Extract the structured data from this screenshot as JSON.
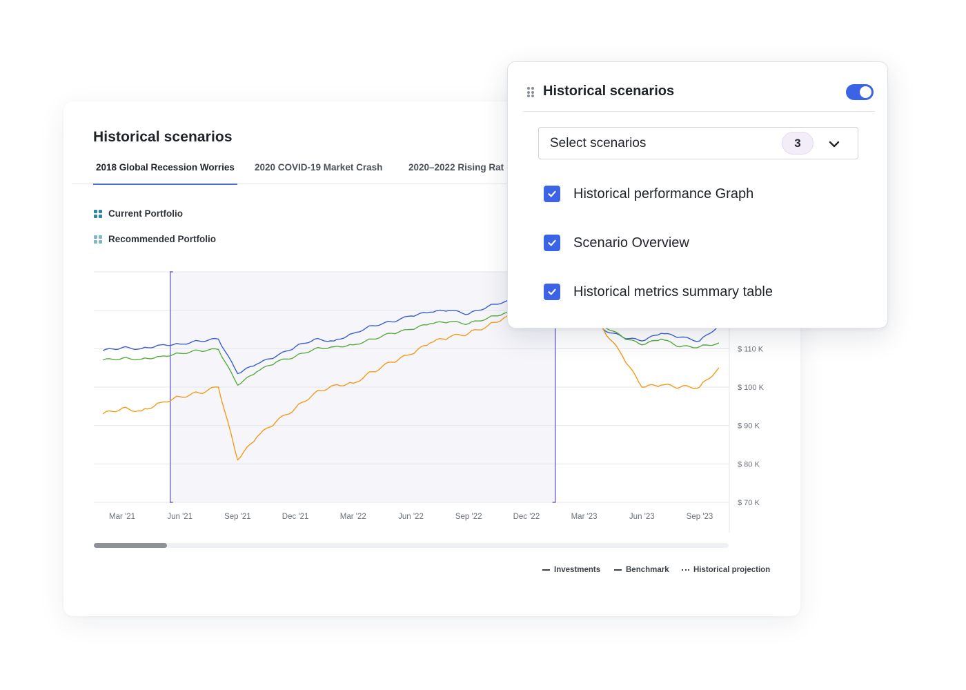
{
  "main_card": {
    "title": "Historical scenarios",
    "tabs": [
      {
        "label": "2018 Global Recession Worries",
        "active": true
      },
      {
        "label": "2020 COVID-19 Market Crash",
        "active": false
      },
      {
        "label": "2020–2022 Rising Rat",
        "active": false
      }
    ],
    "portfolio_legend": [
      {
        "label": "Current Portfolio",
        "color": "#2e86ab"
      },
      {
        "label": "Recommended Portfolio",
        "color": "#7fb8c4"
      }
    ],
    "line_legend": {
      "investments": "Investments",
      "benchmark": "Benchmark",
      "projection": "Historical projection"
    },
    "scrollbar": {
      "position_fraction": 0.0,
      "visible_fraction": 0.115
    }
  },
  "chart_data": {
    "type": "line",
    "x_ticks": [
      "Mar '21",
      "Jun '21",
      "Sep '21",
      "Dec '21",
      "Mar '22",
      "Jun '22",
      "Sep '22",
      "Dec '22",
      "Mar '23",
      "Jun '23",
      "Sep '23"
    ],
    "y_ticks": [
      "$ 110 K",
      "$ 100 K",
      "$ 90 K",
      "$ 80 K",
      "$ 70 K"
    ],
    "ylim": [
      70,
      130
    ],
    "y_unit": "K",
    "highlight_range": [
      "Jun '21",
      "Feb '23"
    ],
    "series": [
      {
        "color": "#3a5fcd",
        "x": [
          "Feb '21",
          "Mar '21",
          "Apr '21",
          "May '21",
          "Jun '21",
          "Jul '21",
          "Aug '21",
          "Sep '21",
          "Oct '21",
          "Nov '21",
          "Dec '21",
          "Jan '22",
          "Feb '22",
          "Mar '22",
          "Apr '22",
          "May '22",
          "Jun '22",
          "Jul '22",
          "Aug '22",
          "Sep '22",
          "Oct '22",
          "Nov '22",
          "Dec '22",
          "Mar '23",
          "Apr '23",
          "May '23",
          "Jun '23",
          "Jul '23",
          "Aug '23",
          "Sep '23",
          "Oct '23"
        ],
        "values": [
          109.5,
          110.3,
          110.0,
          111.0,
          111.2,
          112.0,
          112.5,
          103.5,
          106.0,
          108.0,
          110.5,
          112.5,
          112.0,
          114.0,
          116.0,
          117.0,
          118.5,
          119.5,
          120.0,
          119.0,
          121.0,
          122.5,
          124.0,
          124.0,
          115.0,
          113.0,
          112.0,
          114.0,
          113.0,
          112.0,
          116.0
        ]
      },
      {
        "color": "#5aab3f",
        "x": [
          "Feb '21",
          "Mar '21",
          "Apr '21",
          "May '21",
          "Jun '21",
          "Jul '21",
          "Aug '21",
          "Sep '21",
          "Oct '21",
          "Nov '21",
          "Dec '21",
          "Jan '22",
          "Feb '22",
          "Mar '22",
          "Apr '22",
          "May '22",
          "Jun '22",
          "Jul '22",
          "Aug '22",
          "Sep '22",
          "Oct '22",
          "Nov '22",
          "Dec '22",
          "Mar '23",
          "Apr '23",
          "May '23",
          "Jun '23",
          "Jul '23",
          "Aug '23",
          "Sep '23",
          "Oct '23"
        ],
        "values": [
          107.0,
          107.5,
          107.3,
          108.0,
          108.8,
          109.5,
          109.8,
          100.5,
          104.0,
          106.5,
          108.0,
          110.0,
          110.5,
          111.0,
          112.5,
          114.0,
          115.0,
          116.5,
          117.0,
          116.5,
          118.0,
          119.5,
          120.0,
          120.0,
          116.0,
          113.0,
          111.0,
          112.5,
          110.5,
          110.5,
          111.5
        ]
      },
      {
        "color": "#f29b1a",
        "x": [
          "Feb '21",
          "Mar '21",
          "Apr '21",
          "May '21",
          "Jun '21",
          "Jul '21",
          "Aug '21",
          "Sep '21",
          "Oct '21",
          "Nov '21",
          "Dec '21",
          "Jan '22",
          "Feb '22",
          "Mar '22",
          "Apr '22",
          "May '22",
          "Jun '22",
          "Jul '22",
          "Aug '22",
          "Sep '22",
          "Oct '22",
          "Nov '22",
          "Dec '22",
          "Mar '23",
          "Apr '23",
          "May '23",
          "Jun '23",
          "Jul '23",
          "Aug '23",
          "Sep '23",
          "Oct '23"
        ],
        "values": [
          93.0,
          94.5,
          93.8,
          96.0,
          97.5,
          98.5,
          100.0,
          81.0,
          87.0,
          91.0,
          94.5,
          98.5,
          100.5,
          101.0,
          104.0,
          106.5,
          108.5,
          111.5,
          113.0,
          114.0,
          116.0,
          118.5,
          119.5,
          120.0,
          115.0,
          108.0,
          100.0,
          100.5,
          100.0,
          100.0,
          105.0
        ]
      }
    ]
  },
  "popup": {
    "title": "Historical scenarios",
    "toggle_on": true,
    "select_label": "Select scenarios",
    "select_count": "3",
    "options": [
      {
        "label": "Historical performance Graph",
        "checked": true
      },
      {
        "label": "Scenario Overview",
        "checked": true
      },
      {
        "label": "Historical metrics summary table",
        "checked": true
      }
    ]
  },
  "colors": {
    "accent": "#3a63e6",
    "investments_blue": "#3a5fcd",
    "benchmark_green": "#5aab3f",
    "projection_orange": "#f29b1a",
    "highlight_border": "#6b63c9"
  }
}
